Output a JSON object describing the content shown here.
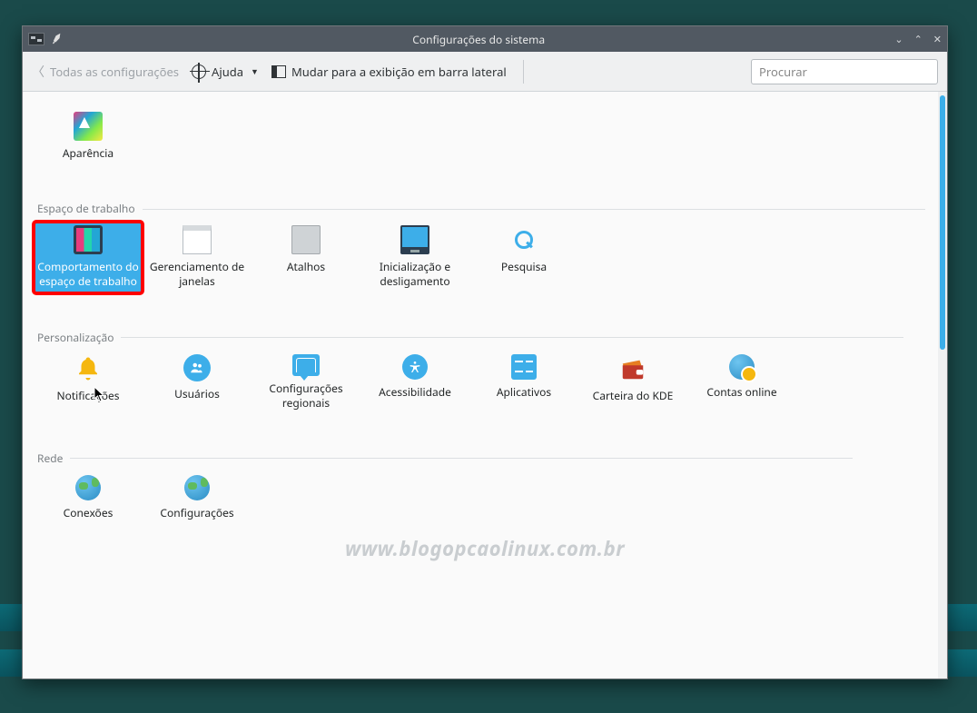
{
  "window": {
    "title": "Configurações do sistema"
  },
  "toolbar": {
    "back_label": "Todas as configurações",
    "help_label": "Ajuda",
    "switch_view_label": "Mudar para a exibição em barra lateral",
    "search_placeholder": "Procurar"
  },
  "first_item": {
    "label": "Aparência"
  },
  "sections": [
    {
      "title": "Espaço de trabalho",
      "items": [
        {
          "id": "workspace-behavior",
          "label": "Comportamento do espaço de trabalho",
          "selected": true,
          "highlighted": true
        },
        {
          "id": "window-management",
          "label": "Gerenciamento de janelas"
        },
        {
          "id": "shortcuts",
          "label": "Atalhos"
        },
        {
          "id": "startup-shutdown",
          "label": "Inicialização e desligamento"
        },
        {
          "id": "search",
          "label": "Pesquisa"
        }
      ]
    },
    {
      "title": "Personalização",
      "items": [
        {
          "id": "notifications",
          "label": "Notificações"
        },
        {
          "id": "users",
          "label": "Usuários"
        },
        {
          "id": "regional",
          "label": "Configurações regionais"
        },
        {
          "id": "accessibility",
          "label": "Acessibilidade"
        },
        {
          "id": "applications",
          "label": "Aplicativos"
        },
        {
          "id": "kde-wallet",
          "label": "Carteira do KDE"
        },
        {
          "id": "online-accounts",
          "label": "Contas online"
        }
      ]
    },
    {
      "title": "Rede",
      "items": [
        {
          "id": "connections",
          "label": "Conexões"
        },
        {
          "id": "net-settings",
          "label": "Configurações"
        }
      ]
    }
  ],
  "watermark": "www.blogopcaolinux.com.br"
}
